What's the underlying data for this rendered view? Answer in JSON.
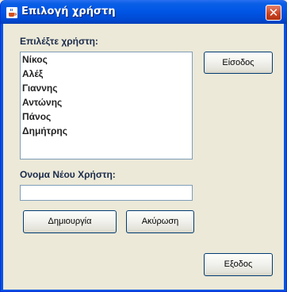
{
  "window": {
    "title": "Επιλογή χρήστη",
    "close_glyph": "✕"
  },
  "form": {
    "select_user_label": "Επιλέξτε χρήστη:",
    "users": [
      "Νίκος",
      "Αλέξ",
      "Γιαννης",
      "Αντώνης",
      "Πάνος",
      "Δημήτρης"
    ],
    "new_user_label": "Ονομα Νέου Χρήστη:",
    "new_user_value": ""
  },
  "buttons": {
    "login": "Είσοδος",
    "create": "Δημιουργία",
    "cancel": "Ακύρωση",
    "exit": "Εξοδος"
  },
  "icons": {
    "title_icon": "java-cup-icon",
    "close_icon": "close-icon"
  }
}
